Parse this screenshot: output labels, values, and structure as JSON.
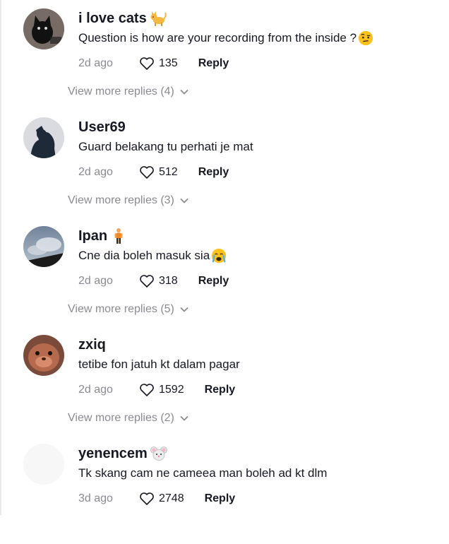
{
  "comments": [
    {
      "username": "i love cats",
      "username_emoji": "cat-emoji",
      "text": "Question is how are your recording from the inside ?",
      "text_emoji": "raised-eyebrow-emoji",
      "time": "2d ago",
      "likes": "135",
      "reply_label": "Reply",
      "view_more": "View more replies (4)",
      "avatar": "black-cat-avatar"
    },
    {
      "username": "User69",
      "username_emoji": "",
      "text": "Guard belakang tu perhati je mat",
      "text_emoji": "",
      "time": "2d ago",
      "likes": "512",
      "reply_label": "Reply",
      "view_more": "View more replies (3)",
      "avatar": "silhouette-avatar"
    },
    {
      "username": "Ipan",
      "username_emoji": "standing-person-emoji",
      "text": "Cne dia boleh masuk sia",
      "text_emoji": "crying-face-emoji",
      "time": "2d ago",
      "likes": "318",
      "reply_label": "Reply",
      "view_more": "View more replies (5)",
      "avatar": "sky-avatar"
    },
    {
      "username": "zxiq",
      "username_emoji": "",
      "text": "tetibe fon jatuh kt dalam pagar",
      "text_emoji": "",
      "time": "2d ago",
      "likes": "1592",
      "reply_label": "Reply",
      "view_more": "View more replies (2)",
      "avatar": "seal-avatar"
    },
    {
      "username": "yenencem",
      "username_emoji": "mouse-emoji",
      "text": "Tk skang cam ne cameea man boleh ad kt dlm",
      "text_emoji": "",
      "time": "3d ago",
      "likes": "2748",
      "reply_label": "Reply",
      "view_more": "",
      "avatar": "blank-avatar"
    }
  ],
  "colors": {
    "text_primary": "#161823",
    "text_secondary": "#8a8b91",
    "background": "#ffffff"
  }
}
